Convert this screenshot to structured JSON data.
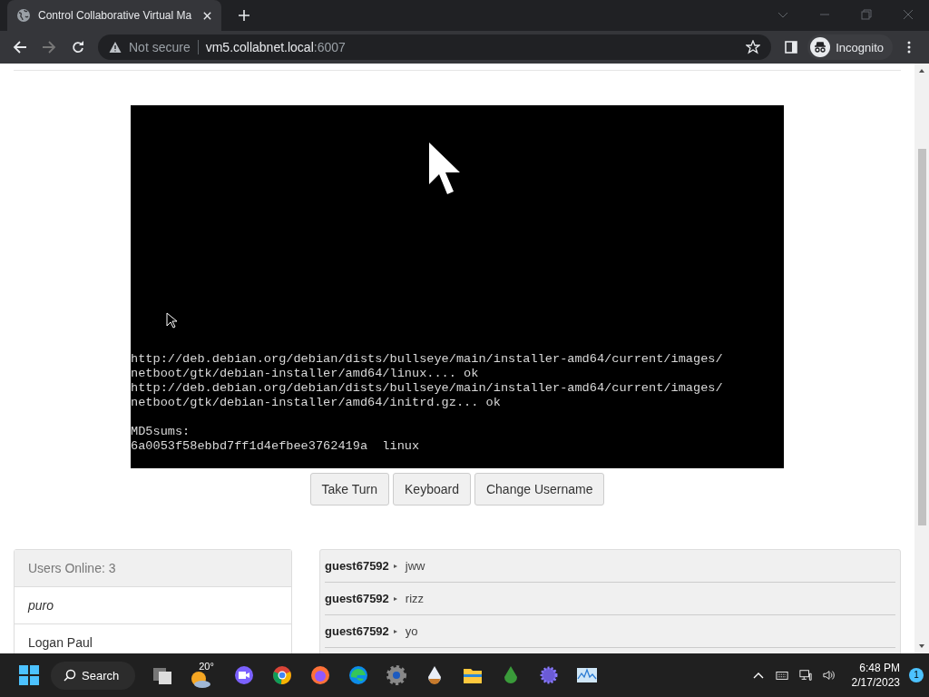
{
  "browser": {
    "tab_title": "Control Collaborative Virtual Ma",
    "address": {
      "security": "Not secure",
      "host": "vm5.collabnet.local",
      "port": ":6007"
    },
    "profile": "Incognito"
  },
  "vm": {
    "console_blocks": [
      [
        "http://deb.debian.org/debian/dists/bullseye/main/installer-amd64/current/images/",
        "netboot/gtk/debian-installer/amd64/linux.... ok",
        "http://deb.debian.org/debian/dists/bullseye/main/installer-amd64/current/images/",
        "netboot/gtk/debian-installer/amd64/initrd.gz... ok"
      ],
      [
        "MD5sums:",
        "6a0053f58ebbd7ff1d4efbee3762419a  linux"
      ]
    ],
    "buttons": [
      "Take Turn",
      "Keyboard",
      "Change Username"
    ]
  },
  "users": {
    "header": "Users Online: 3",
    "list": [
      {
        "name": "puro",
        "kind": "self"
      },
      {
        "name": "Logan Paul",
        "kind": "other"
      }
    ]
  },
  "chat": {
    "messages": [
      {
        "user": "guest67592",
        "text": "jww"
      },
      {
        "user": "guest67592",
        "text": "rizz"
      },
      {
        "user": "guest67592",
        "text": "yo"
      }
    ]
  },
  "taskbar": {
    "search": "Search",
    "weather": "20°",
    "time": "6:48 PM",
    "date": "2/17/2023",
    "notifications": "1"
  }
}
